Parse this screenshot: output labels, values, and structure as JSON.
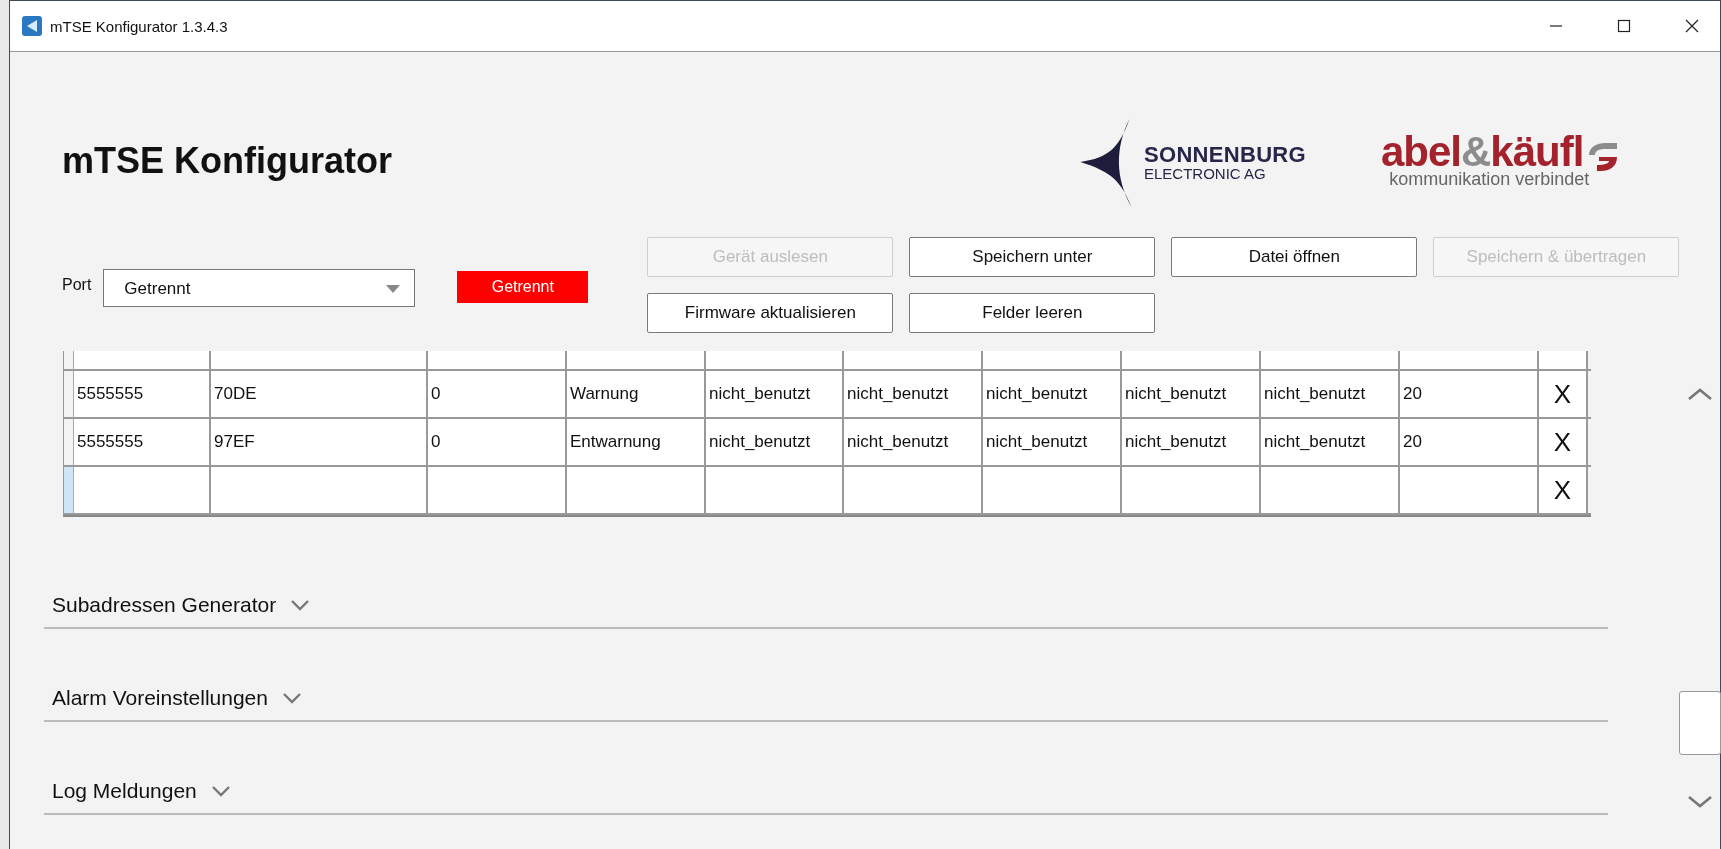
{
  "window": {
    "title": "mTSE Konfigurator 1.3.4.3"
  },
  "header": {
    "title": "mTSE Konfigurator"
  },
  "logo_sonnenburg": {
    "name": "SONNENBURG",
    "subtitle": "ELECTRONIC AG"
  },
  "logo_abel": {
    "parts": [
      {
        "text": "abel",
        "color": "#a3222b"
      },
      {
        "text": "&",
        "color": "#8c8c8c"
      },
      {
        "text": "käufl",
        "color": "#a3222b"
      }
    ],
    "tagline": "kommunikation verbindet"
  },
  "port": {
    "label": "Port",
    "value": "Getrennt",
    "status": "Getrennt"
  },
  "buttons": [
    {
      "label": "Gerät auslesen",
      "disabled": true
    },
    {
      "label": "Speichern unter",
      "disabled": false
    },
    {
      "label": "Datei öffnen",
      "disabled": false
    },
    {
      "label": "Speichern & übertragen",
      "disabled": true
    },
    {
      "label": "Firmware aktualisieren",
      "disabled": false
    },
    {
      "label": "Felder leeren",
      "disabled": false
    }
  ],
  "table": {
    "clipped_top_row": true,
    "rows": [
      {
        "selected": false,
        "cells": [
          "5555555",
          "70DE",
          "0",
          "Warnung",
          "nicht_benutzt",
          "nicht_benutzt",
          "nicht_benutzt",
          "nicht_benutzt",
          "nicht_benutzt",
          "20"
        ],
        "delete": "X"
      },
      {
        "selected": false,
        "cells": [
          "5555555",
          "97EF",
          "0",
          "Entwarnung",
          "nicht_benutzt",
          "nicht_benutzt",
          "nicht_benutzt",
          "nicht_benutzt",
          "nicht_benutzt",
          "20"
        ],
        "delete": "X"
      },
      {
        "selected": true,
        "cells": [],
        "delete": "X"
      }
    ]
  },
  "sections": [
    {
      "title": "Subadressen Generator",
      "expanded": false
    },
    {
      "title": "Alarm Voreinstellungen",
      "expanded": false
    },
    {
      "title": "Log Meldungen",
      "expanded": false
    }
  ]
}
